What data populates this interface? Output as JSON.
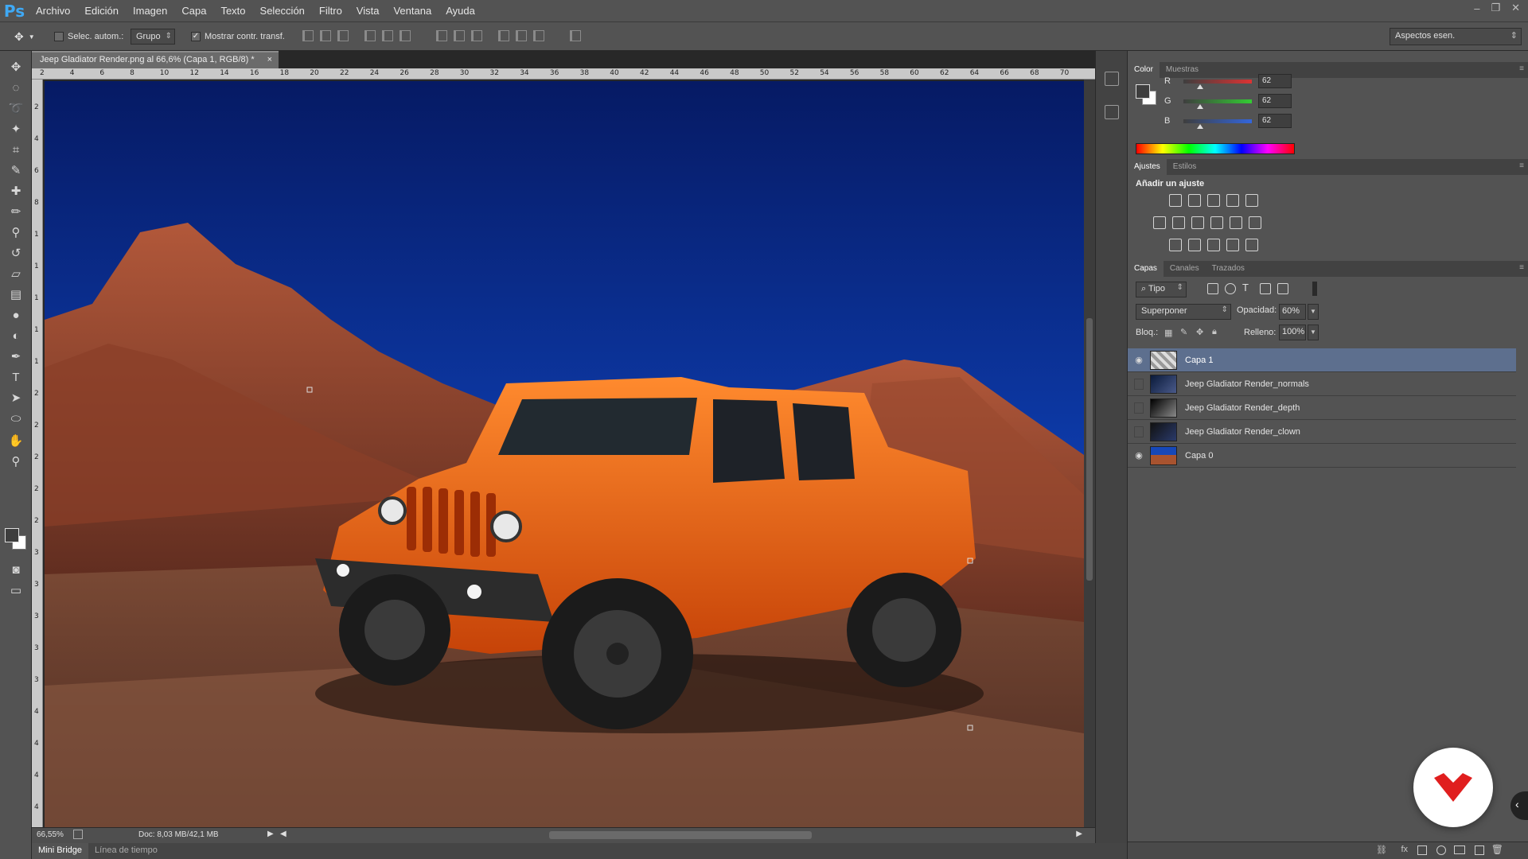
{
  "app": {
    "logo": "Ps",
    "window_controls": [
      "–",
      "❐",
      "✕"
    ]
  },
  "menu": [
    "Archivo",
    "Edición",
    "Imagen",
    "Capa",
    "Texto",
    "Selección",
    "Filtro",
    "Vista",
    "Ventana",
    "Ayuda"
  ],
  "options": {
    "auto_select_label": "Selec. autom.:",
    "auto_select_checked": false,
    "auto_select_target": "Grupo",
    "show_transform_label": "Mostrar contr. transf.",
    "show_transform_checked": true,
    "workspace": "Aspectos esen."
  },
  "document": {
    "tab_title": "Jeep Gladiator Render.png al 66,6% (Capa 1, RGB/8) *",
    "close_glyph": "×",
    "zoom": "66,55%",
    "doc_info": "Doc: 8,03 MB/42,1 MB",
    "ruler_top": [
      "2",
      "4",
      "6",
      "8",
      "10",
      "12",
      "14",
      "16",
      "18",
      "20",
      "22",
      "24",
      "26",
      "28",
      "30",
      "32",
      "34",
      "36",
      "38",
      "40",
      "42",
      "44",
      "46",
      "48",
      "50",
      "52",
      "54",
      "56",
      "58",
      "60",
      "62",
      "64",
      "66",
      "68",
      "70"
    ],
    "ruler_left": [
      "2",
      "4",
      "6",
      "8",
      "1",
      "1",
      "1",
      "1",
      "1",
      "2",
      "2",
      "2",
      "2",
      "2",
      "3",
      "3",
      "3",
      "3",
      "3",
      "4",
      "4",
      "4",
      "4"
    ]
  },
  "bottom_tabs": [
    "Mini Bridge",
    "Línea de tiempo"
  ],
  "color_panel": {
    "tabs": [
      "Color",
      "Muestras"
    ],
    "channels": [
      {
        "label": "R",
        "value": "62",
        "fraction": 0.243,
        "color": "#d33"
      },
      {
        "label": "G",
        "value": "62",
        "fraction": 0.243,
        "color": "#3c3"
      },
      {
        "label": "B",
        "value": "62",
        "fraction": 0.243,
        "color": "#36d"
      }
    ],
    "foreground": "#3e3e3e",
    "background": "#ffffff"
  },
  "adjustments_panel": {
    "tabs": [
      "Ajustes",
      "Estilos"
    ],
    "heading": "Añadir un ajuste",
    "icons": [
      [
        "brightness-icon",
        "levels-icon",
        "curves-icon",
        "exposure-icon",
        "vibrance-icon"
      ],
      [
        "hue-saturation-icon",
        "color-balance-icon",
        "black-white-icon",
        "photo-filter-icon",
        "channel-mixer-icon",
        "color-lookup-icon"
      ],
      [
        "invert-icon",
        "posterize-icon",
        "threshold-icon",
        "selective-color-icon",
        "gradient-map-icon"
      ]
    ]
  },
  "layers_panel": {
    "tabs": [
      "Capas",
      "Canales",
      "Trazados"
    ],
    "filter_kind": "Tipo",
    "blend_mode": "Superponer",
    "opacity_label": "Opacidad:",
    "opacity_value": "60%",
    "lock_label": "Bloq.:",
    "fill_label": "Relleno:",
    "fill_value": "100%",
    "layers": [
      {
        "name": "Capa 1",
        "visible": true,
        "selected": true
      },
      {
        "name": "Jeep Gladiator Render_normals",
        "visible": false,
        "selected": false
      },
      {
        "name": "Jeep Gladiator Render_depth",
        "visible": false,
        "selected": false
      },
      {
        "name": "Jeep Gladiator Render_clown",
        "visible": false,
        "selected": false
      },
      {
        "name": "Capa 0",
        "visible": true,
        "selected": false
      }
    ]
  },
  "colors": {
    "selected_layer": "#5d6f8e",
    "fab_accent": "#e01e1e"
  }
}
